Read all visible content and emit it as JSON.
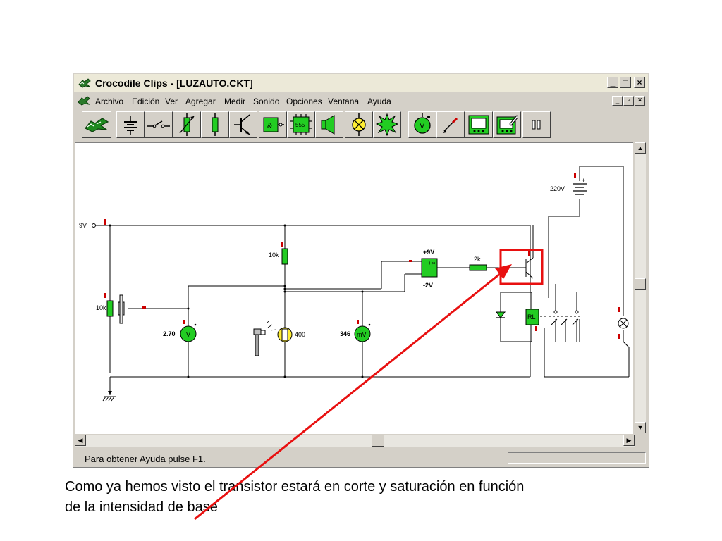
{
  "window": {
    "title": "Crocodile Clips - [LUZAUTO.CKT]",
    "caption_buttons": [
      "_",
      "□",
      "×"
    ],
    "mdi_buttons": [
      "_",
      "▫",
      "×"
    ]
  },
  "menu": [
    "Archivo",
    "Edición",
    "Ver",
    "Agregar",
    "Medir",
    "Sonido",
    "Opciones",
    "Ventana",
    "Ayuda"
  ],
  "toolbar": {
    "buttons": [
      {
        "name": "crocodile-icon"
      },
      {
        "name": "battery-icon"
      },
      {
        "name": "switch-icon"
      },
      {
        "name": "variable-resistor-icon"
      },
      {
        "name": "resistor-icon"
      },
      {
        "name": "transistor-icon"
      },
      {
        "name": "logic-gate-icon",
        "label": "&"
      },
      {
        "name": "chip-icon",
        "label": "555"
      },
      {
        "name": "speaker-icon"
      },
      {
        "name": "lamp-icon"
      },
      {
        "name": "burst-icon"
      },
      {
        "name": "voltmeter-icon",
        "label": "V"
      },
      {
        "name": "probe-icon"
      },
      {
        "name": "oscilloscope-icon"
      },
      {
        "name": "graph-edit-icon"
      },
      {
        "name": "pause-icon"
      }
    ]
  },
  "circuit": {
    "supply_label": "9V",
    "mains_label": "220V",
    "res_top_label": "10k",
    "pot_label": "10k",
    "res_base_label": "2k",
    "opamp_pos_label": "+9V",
    "opamp_neg_label": "-2V",
    "opamp_sign": "+∞",
    "meter1_value": "2.70",
    "meter1_unit": "V",
    "ldr_value": "400",
    "meter2_value": "346",
    "meter2_unit": "mV",
    "relay_label": "RL",
    "battery_plus": "+"
  },
  "status": {
    "text": "Para obtener Ayuda pulse F1."
  },
  "caption": {
    "line1": "Como ya hemos visto el transistor estará en corte y saturación en función",
    "line2": "de la intensidad de base"
  },
  "colors": {
    "component_green": "#22cc22",
    "marker_red": "#cc0000",
    "highlight_red": "#e81010",
    "window_face": "#d4d0c8",
    "title_bar": "#ece9d8"
  }
}
